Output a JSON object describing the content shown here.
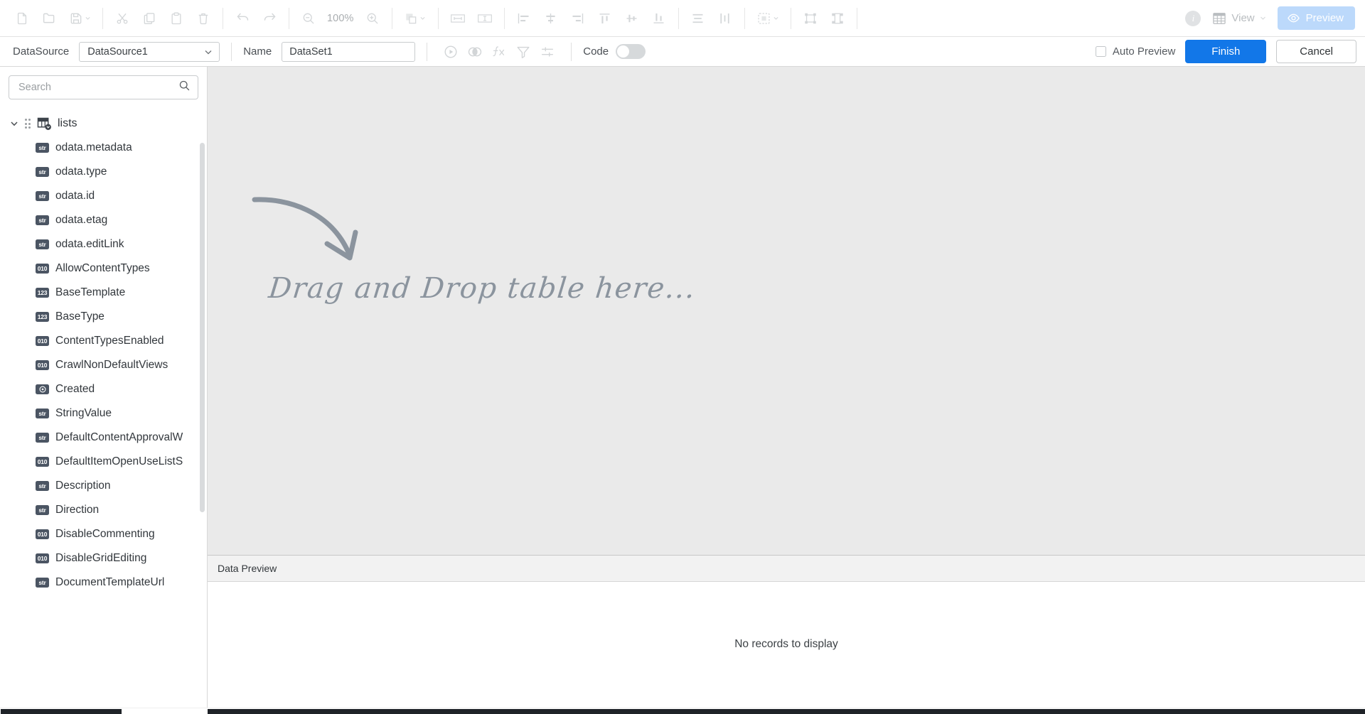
{
  "toolbar": {
    "groups": [
      {
        "name": "file",
        "items": [
          {
            "icon": "new-document-icon",
            "label": "New"
          },
          {
            "icon": "open-folder-icon",
            "label": "Open"
          },
          {
            "icon": "save-icon",
            "label": "Save",
            "caret": true
          }
        ]
      },
      {
        "name": "clipboard",
        "items": [
          {
            "icon": "cut-icon",
            "label": "Cut"
          },
          {
            "icon": "copy-icon",
            "label": "Copy"
          },
          {
            "icon": "paste-icon",
            "label": "Paste"
          },
          {
            "icon": "delete-icon",
            "label": "Delete"
          }
        ]
      },
      {
        "name": "history",
        "items": [
          {
            "icon": "undo-icon",
            "label": "Undo"
          },
          {
            "icon": "redo-icon",
            "label": "Redo"
          }
        ]
      },
      {
        "name": "zoom",
        "items": [
          {
            "icon": "zoom-out-icon",
            "label": "Zoom Out"
          },
          {
            "icon": "zoom-in-icon",
            "label": "Zoom In"
          }
        ]
      }
    ],
    "zoom_level": "100%",
    "arrange_label": "Arrange",
    "info_glyph": "i",
    "view_label": "View",
    "preview_label": "Preview"
  },
  "subbar": {
    "datasource_label": "DataSource",
    "datasource_value": "DataSource1",
    "name_label": "Name",
    "name_value": "DataSet1",
    "name_placeholder": "Name",
    "actions": [
      {
        "icon": "run-query-icon",
        "label": "Run"
      },
      {
        "icon": "join-merge-icon",
        "label": "Join"
      },
      {
        "icon": "function-fx-icon",
        "label": "Calculated Field"
      },
      {
        "icon": "filter-funnel-icon",
        "label": "Filter"
      },
      {
        "icon": "parameters-icon",
        "label": "Parameters"
      }
    ],
    "code_label": "Code",
    "code_enabled": false,
    "auto_preview_label": "Auto Preview",
    "auto_preview_checked": false,
    "finish_label": "Finish",
    "cancel_label": "Cancel"
  },
  "sidebar": {
    "search_placeholder": "Search",
    "search_value": "",
    "root": {
      "label": "lists",
      "icon": "table-source-icon",
      "expanded": true
    },
    "fields": [
      {
        "label": "odata.metadata",
        "type": "str"
      },
      {
        "label": "odata.type",
        "type": "str"
      },
      {
        "label": "odata.id",
        "type": "str"
      },
      {
        "label": "odata.etag",
        "type": "str"
      },
      {
        "label": "odata.editLink",
        "type": "str"
      },
      {
        "label": "AllowContentTypes",
        "type": "010"
      },
      {
        "label": "BaseTemplate",
        "type": "123"
      },
      {
        "label": "BaseType",
        "type": "123"
      },
      {
        "label": "ContentTypesEnabled",
        "type": "010"
      },
      {
        "label": "CrawlNonDefaultViews",
        "type": "010"
      },
      {
        "label": "Created",
        "type": "date"
      },
      {
        "label": "StringValue",
        "type": "str"
      },
      {
        "label": "DefaultContentApprovalW",
        "type": "str"
      },
      {
        "label": "DefaultItemOpenUseListS",
        "type": "010"
      },
      {
        "label": "Description",
        "type": "str"
      },
      {
        "label": "Direction",
        "type": "str"
      },
      {
        "label": "DisableCommenting",
        "type": "010"
      },
      {
        "label": "DisableGridEditing",
        "type": "010"
      },
      {
        "label": "DocumentTemplateUrl",
        "type": "str"
      }
    ]
  },
  "canvas": {
    "dropzone_text": "Drag and Drop table here...",
    "arrow_icon": "curved-arrow-icon"
  },
  "data_preview": {
    "title": "Data Preview",
    "empty_message": "No records to display"
  },
  "colors": {
    "accent": "#1277e8",
    "preview_button": "#bcd9fb",
    "canvas_bg": "#eaeaea",
    "badge_bg": "#4b5563",
    "dropzone_text": "#8b949e"
  }
}
